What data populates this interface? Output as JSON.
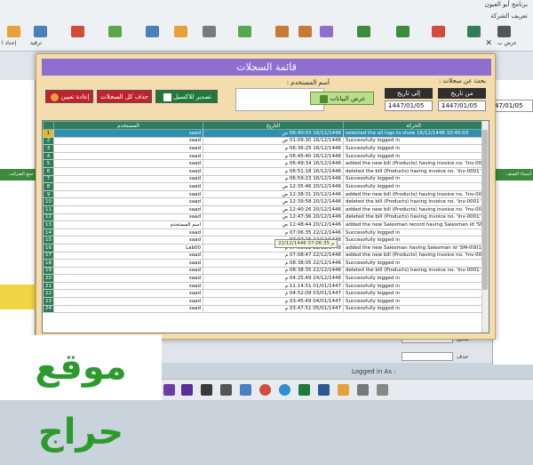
{
  "app": {
    "top_title": "برنامج أبو العيون",
    "top_subtitle": "تعريف الشركة",
    "toolbar_labels": {
      "left_1": "إعداد ا",
      "left_2": "ترقية",
      "right_1": "عرض ب"
    },
    "logged_in_label": "Logged in As :"
  },
  "background": {
    "left_bar_label": "جمع الضرائب",
    "right_bar_label": "أسماء الصنف",
    "right_date": "47/01/05",
    "right_labels": [
      "تعديل",
      "حذف"
    ]
  },
  "dialog": {
    "title": "قائمة السجلات",
    "search_label": "بحث عن سجلات :",
    "from_label": "من تاريخ",
    "to_label": "إلى تاريخ",
    "from_date": "1447/01/05",
    "to_date": "1447/01/05",
    "user_label": "أسم المستخدم :",
    "user_value": "",
    "show_button": "عرض البيانات",
    "excel_button": "تصدير للاكسيل",
    "delete_button": "حذف كل السجلات",
    "reset_button": "إعادة تعيين",
    "grid": {
      "columns": [
        "المستخدم",
        "التاريخ",
        "الحركة"
      ],
      "rows": [
        {
          "n": "1",
          "user": "saad",
          "date": "16/12/1446 06:40:03 ص",
          "action": "selected the all logs to show  16/12/1446 10:40:03",
          "sel": true
        },
        {
          "n": "2",
          "user": "saad",
          "date": "16/12/1446 01:09:30 ص",
          "action": "Successfully logged in"
        },
        {
          "n": "3",
          "user": "saad",
          "date": "16/12/1446 06:36:25 م",
          "action": "Successfully logged in"
        },
        {
          "n": "4",
          "user": "saad",
          "date": "16/12/1446 06:45:40 م",
          "action": "Successfully logged in"
        },
        {
          "n": "5",
          "user": "saad",
          "date": "16/12/1446 06:49:34 م",
          "action": "added the new bill (Products) having invoice no. 'Inv-0001'"
        },
        {
          "n": "6",
          "user": "saad",
          "date": "16/12/1446 06:51:18 م",
          "action": "deleted the bill (Products) having invoice no. 'Inv-0001'"
        },
        {
          "n": "7",
          "user": "saad",
          "date": "16/12/1446 06:59:23 م",
          "action": "Successfully logged in"
        },
        {
          "n": "8",
          "user": "saad",
          "date": "20/12/1446 12:35:46 ص",
          "action": "Successfully logged in"
        },
        {
          "n": "9",
          "user": "saad",
          "date": "20/12/1446 12:38:31 ص",
          "action": "added the new bill (Products) having invoice no. 'Inv-0001'"
        },
        {
          "n": "10",
          "user": "saad",
          "date": "20/12/1446 12:39:58 ص",
          "action": "deleted the bill (Products) having invoice no. 'Inv-0001'"
        },
        {
          "n": "11",
          "user": "saad",
          "date": "20/12/1446 12:40:26 ص",
          "action": "added the new bill (Products) having invoice no. 'Inv-0001'"
        },
        {
          "n": "12",
          "user": "saad",
          "date": "20/12/1446 12:47:36 ص",
          "action": "deleted the bill (Products) having invoice no. 'Inv-0001'"
        },
        {
          "n": "13",
          "user": "اسم المستخدم",
          "date": "20/12/1446 12:48:44 ص",
          "action": "added the new Salesman record having Salesman id 'SM-0001'"
        },
        {
          "n": "14",
          "user": "saad",
          "date": "22/12/1446 07:06:35 م",
          "action": "Successfully logged in"
        },
        {
          "n": "15",
          "user": "saad",
          "date": "22/12/1446 07:07:15 م",
          "action": "Successfully logged in"
        },
        {
          "n": "16",
          "user": "Lab00",
          "date": "22/12/1446 07:08:22 م",
          "action": "added the new Salesman having Salesman id 'SM-0001'"
        },
        {
          "n": "17",
          "user": "saad",
          "date": "22/12/1446 07:08:47 م",
          "action": "added the new bill (Products) having invoice no. 'Inv-0001'"
        },
        {
          "n": "18",
          "user": "saad",
          "date": "22/12/1446 08:38:05 م",
          "action": "Successfully logged in"
        },
        {
          "n": "19",
          "user": "saad",
          "date": "22/12/1446 08:38:35 م",
          "action": "deleted the bill (Products) having invoice no. 'Inv-0001'"
        },
        {
          "n": "20",
          "user": "saad",
          "date": "24/12/1446 04:25:49 م",
          "action": "Successfully logged in"
        },
        {
          "n": "21",
          "user": "saad",
          "date": "01/01/1447 11:14:51 م",
          "action": "Successfully logged in"
        },
        {
          "n": "22",
          "user": "saad",
          "date": "03/01/1447 04:52:09 م",
          "action": "Successfully logged in"
        },
        {
          "n": "23",
          "user": "saad",
          "date": "04/01/1447 03:45:49 م",
          "action": "Successfully logged in"
        },
        {
          "n": "24",
          "user": "saad",
          "date": "05/01/1447 03:47:51 م",
          "action": "Successfully logged in"
        }
      ]
    },
    "tooltip": "22/12/1446 07:06:35 م"
  },
  "watermark": "موقع حراج",
  "colors": {
    "accent": "#8e6fcf",
    "dialog_bg": "#f3dcae",
    "header": "#2f7d5b",
    "selected": "#2f8fb0",
    "danger": "#c0222c",
    "excel": "#1f7a3a"
  }
}
